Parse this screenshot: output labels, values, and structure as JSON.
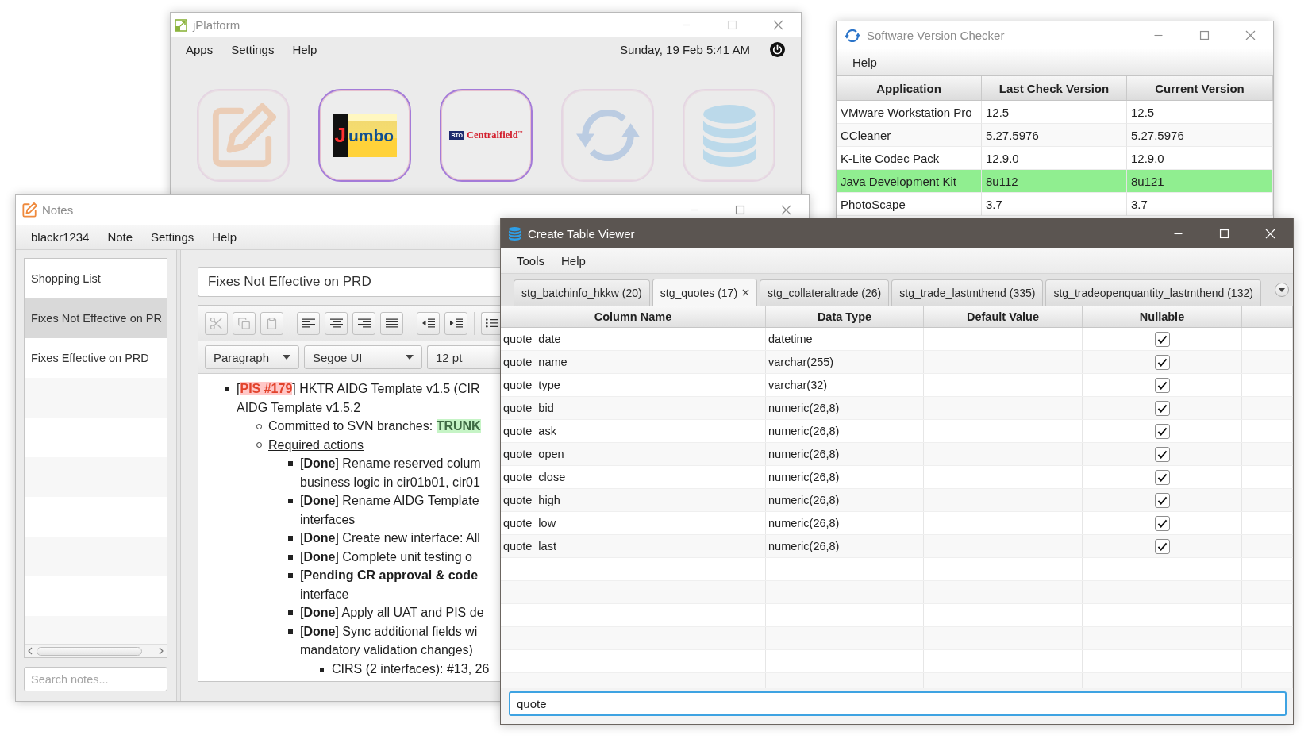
{
  "launcher_window": {
    "title": "jPlatform",
    "active": false,
    "maximizable": false,
    "menu": [
      "Apps",
      "Settings",
      "Help"
    ],
    "clock": "Sunday, 19 Feb 5:41 AM",
    "apps": [
      {
        "kind": "notes",
        "disabled": true
      },
      {
        "kind": "jumbo",
        "disabled": false,
        "label": "Jumbo"
      },
      {
        "kind": "centralfield",
        "disabled": false,
        "badge": "BTO",
        "label": "Centralfield$^{™}$"
      },
      {
        "kind": "sync",
        "disabled": true
      },
      {
        "kind": "database",
        "disabled": true
      }
    ]
  },
  "version_checker_window": {
    "title": "Software Version Checker",
    "active": false,
    "maximizable": true,
    "menu": [
      "Help"
    ],
    "columns": [
      "Application",
      "Last Check Version",
      "Current Version"
    ],
    "rows": [
      {
        "cells": [
          "VMware Workstation Pro",
          "12.5",
          "12.5"
        ],
        "highlighted": false
      },
      {
        "cells": [
          "CCleaner",
          "5.27.5976",
          "5.27.5976"
        ],
        "highlighted": false
      },
      {
        "cells": [
          "K-Lite Codec Pack",
          "12.9.0",
          "12.9.0"
        ],
        "highlighted": false
      },
      {
        "cells": [
          "Java Development Kit",
          "8u112",
          "8u121"
        ],
        "highlighted": true
      },
      {
        "cells": [
          "PhotoScape",
          "3.7",
          "3.7"
        ],
        "highlighted": false
      }
    ]
  },
  "notes_window": {
    "title": "Notes",
    "active": false,
    "maximizable": true,
    "menu": [
      "blackr1234",
      "Note",
      "Settings",
      "Help"
    ],
    "notes": [
      {
        "title": "Shopping List",
        "selected": false
      },
      {
        "title": "Fixes Not Effective on PR",
        "selected": true
      },
      {
        "title": "Fixes Effective on PRD",
        "selected": false
      }
    ],
    "search": {
      "placeholder": "Search notes..."
    },
    "note_title": "Fixes Not Effective on PRD",
    "toolbar_groups": [
      [
        {
          "kind": "cut",
          "disabled": true
        },
        {
          "kind": "copy",
          "disabled": true
        },
        {
          "kind": "paste",
          "disabled": true
        }
      ],
      [
        {
          "kind": "align-left",
          "disabled": false
        },
        {
          "kind": "align-center",
          "disabled": false
        },
        {
          "kind": "align-right",
          "disabled": false
        },
        {
          "kind": "justify",
          "disabled": false
        }
      ],
      [
        {
          "kind": "outdent",
          "disabled": false
        },
        {
          "kind": "indent",
          "disabled": false
        }
      ],
      [
        {
          "kind": "bullet-list",
          "disabled": false
        }
      ]
    ],
    "format_controls": [
      {
        "kind": "dropdown",
        "value": "Paragraph"
      },
      {
        "kind": "dropdown",
        "value": "Segoe UI"
      },
      {
        "kind": "size",
        "value": "12 pt"
      }
    ],
    "content": [
      {
        "lines": [
          [
            {
              "kind": "plain",
              "text": "["
            },
            {
              "kind": "red-tag",
              "text": "PIS #179"
            },
            {
              "kind": "plain",
              "text": "] HKTR AIDG Template v1.5 (CIR"
            }
          ],
          [
            {
              "kind": "plain",
              "text": "AIDG Template v1.5.2"
            }
          ]
        ],
        "children": [
          {
            "lines": [
              [
                {
                  "kind": "plain",
                  "text": "Committed to SVN branches: "
                },
                {
                  "kind": "green-tag",
                  "text": "TRUNK"
                }
              ]
            ]
          },
          {
            "lines": [
              [
                {
                  "kind": "underline",
                  "text": "Required actions"
                }
              ]
            ],
            "children": [
              {
                "lines": [
                  [
                    {
                      "kind": "plain",
                      "text": "[**Done**] Rename reserved colum"
                    }
                  ],
                  [
                    {
                      "kind": "plain",
                      "text": "business logic in cir01b01, cir01"
                    }
                  ]
                ]
              },
              {
                "lines": [
                  [
                    {
                      "kind": "plain",
                      "text": "[**Done**] Rename AIDG Template"
                    }
                  ],
                  [
                    {
                      "kind": "plain",
                      "text": "interfaces"
                    }
                  ]
                ]
              },
              {
                "lines": [
                  [
                    {
                      "kind": "plain",
                      "text": "[**Done**] Create new interface: All"
                    }
                  ]
                ]
              },
              {
                "lines": [
                  [
                    {
                      "kind": "plain",
                      "text": "[**Done**] Complete unit testing o"
                    }
                  ]
                ]
              },
              {
                "lines": [
                  [
                    {
                      "kind": "plain",
                      "text": "[**Pending CR approval & code**"
                    }
                  ],
                  [
                    {
                      "kind": "plain",
                      "text": "interface"
                    }
                  ]
                ]
              },
              {
                "lines": [
                  [
                    {
                      "kind": "plain",
                      "text": "[**Done**] Apply all UAT and PIS de"
                    }
                  ]
                ]
              },
              {
                "lines": [
                  [
                    {
                      "kind": "plain",
                      "text": "[**Done**] Sync additional fields wi"
                    }
                  ],
                  [
                    {
                      "kind": "plain",
                      "text": "mandatory validation changes)"
                    }
                  ]
                ],
                "children": [
                  {
                    "lines": [
                      [
                        {
                          "kind": "plain",
                          "text": "CIRS (2 interfaces): #13, 26"
                        }
                      ]
                    ]
                  }
                ]
              }
            ]
          }
        ]
      }
    ]
  },
  "table_viewer_window": {
    "title": "Create Table Viewer",
    "active": true,
    "maximizable": true,
    "menu": [
      "Tools",
      "Help"
    ],
    "tabs": [
      {
        "label": "stg_batchinfo_hkkw (20)",
        "selected": false
      },
      {
        "label": "stg_quotes (17)",
        "selected": true
      },
      {
        "label": "stg_collateraltrade (26)",
        "selected": false
      },
      {
        "label": "stg_trade_lastmthend (335)",
        "selected": false
      },
      {
        "label": "stg_tradeopenquantity_lastmthend (132)",
        "selected": false
      }
    ],
    "columns": [
      "Column Name",
      "Data Type",
      "Default Value",
      "Nullable"
    ],
    "rows": [
      {
        "name": "quote_date",
        "type": "datetime",
        "nullable": true
      },
      {
        "name": "quote_name",
        "type": "varchar(255)",
        "nullable": true
      },
      {
        "name": "quote_type",
        "type": "varchar(32)",
        "nullable": true
      },
      {
        "name": "quote_bid",
        "type": "numeric(26,8)",
        "nullable": true
      },
      {
        "name": "quote_ask",
        "type": "numeric(26,8)",
        "nullable": true
      },
      {
        "name": "quote_open",
        "type": "numeric(26,8)",
        "nullable": true
      },
      {
        "name": "quote_close",
        "type": "numeric(26,8)",
        "nullable": true
      },
      {
        "name": "quote_high",
        "type": "numeric(26,8)",
        "nullable": true
      },
      {
        "name": "quote_low",
        "type": "numeric(26,8)",
        "nullable": true
      },
      {
        "name": "quote_last",
        "type": "numeric(26,8)",
        "nullable": true
      }
    ],
    "filter": {
      "value": "quote"
    }
  }
}
